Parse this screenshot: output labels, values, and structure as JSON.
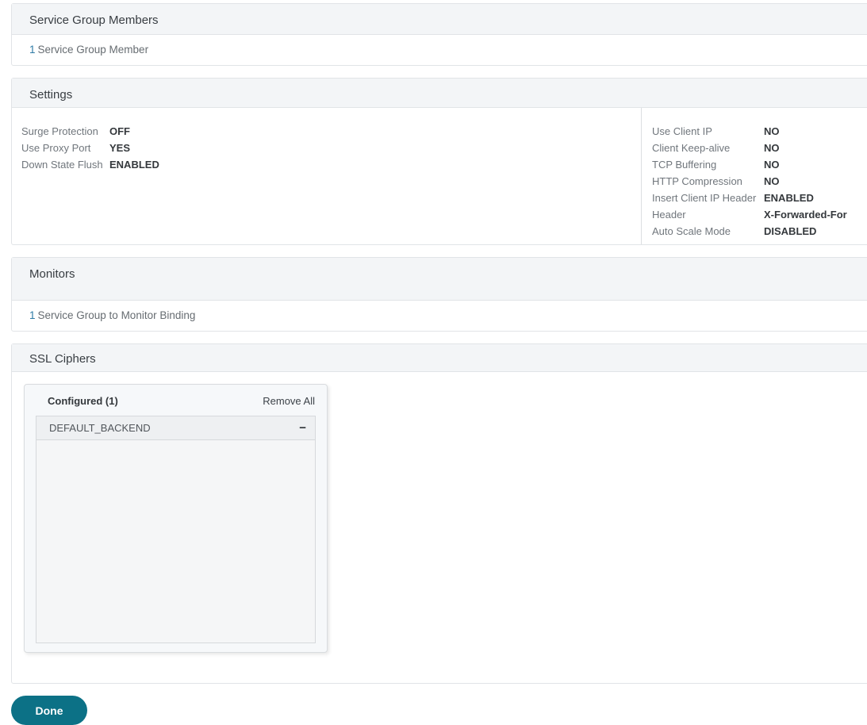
{
  "colors": {
    "accent_teal": "#0c7186",
    "link_blue": "#2e7ba6",
    "header_band": "#f3f5f7",
    "panel_border": "#e1e4e7"
  },
  "icons": {
    "minus": "−"
  },
  "sections": {
    "service_group_members": {
      "title": "Service Group Members",
      "binding_count": "1",
      "binding_label": "Service Group Member"
    },
    "settings": {
      "title": "Settings",
      "left": [
        {
          "label": "Surge Protection",
          "value": "OFF"
        },
        {
          "label": "Use Proxy Port",
          "value": "YES"
        },
        {
          "label": "Down State Flush",
          "value": "ENABLED"
        }
      ],
      "right": [
        {
          "label": "Use Client IP",
          "value": "NO"
        },
        {
          "label": "Client Keep-alive",
          "value": "NO"
        },
        {
          "label": "TCP Buffering",
          "value": "NO"
        },
        {
          "label": "HTTP Compression",
          "value": "NO"
        },
        {
          "label": "Insert Client IP Header",
          "value": "ENABLED"
        },
        {
          "label": "Header",
          "value": "X-Forwarded-For"
        },
        {
          "label": "Auto Scale Mode",
          "value": "DISABLED"
        }
      ]
    },
    "monitors": {
      "title": "Monitors",
      "binding_count": "1",
      "binding_label": "Service Group to Monitor Binding"
    },
    "ssl_ciphers": {
      "title": "SSL Ciphers",
      "configured_label": "Configured (1)",
      "remove_all_label": "Remove All",
      "ciphers": [
        {
          "name": "DEFAULT_BACKEND"
        }
      ]
    }
  },
  "footer": {
    "done_label": "Done"
  }
}
